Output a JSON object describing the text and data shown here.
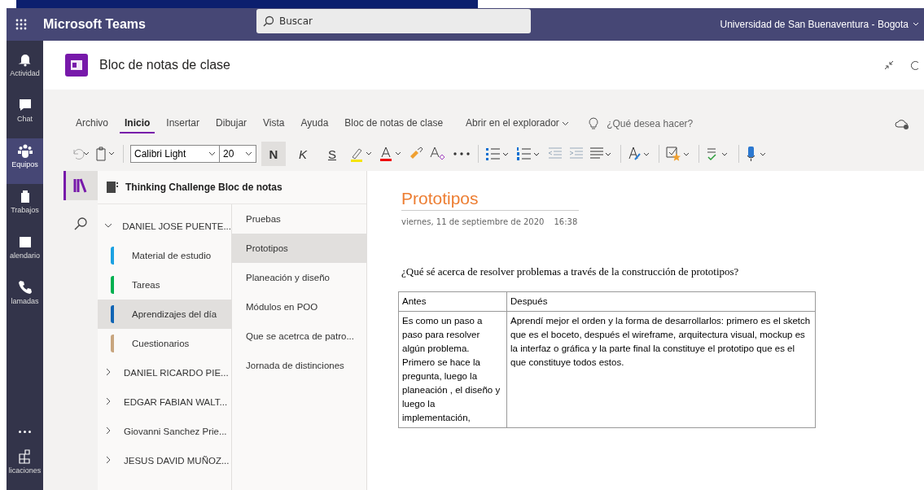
{
  "app": {
    "title": "Microsoft Teams",
    "search": {
      "placeholder": "Buscar"
    },
    "organization": "Universidad de San Buenaventura - Bogota"
  },
  "rail": [
    {
      "label": "Actividad",
      "selected": false
    },
    {
      "label": "Chat",
      "selected": false
    },
    {
      "label": "Equipos",
      "selected": true
    },
    {
      "label": "Trabajos",
      "selected": false
    },
    {
      "label": "alendario",
      "selected": false
    },
    {
      "label": "lamadas",
      "selected": false
    },
    {
      "label": "licaciones",
      "selected": false
    }
  ],
  "header": {
    "title": "Bloc de notas de clase"
  },
  "ribbon": {
    "tabs": [
      {
        "label": "Archivo",
        "selected": false
      },
      {
        "label": "Inicio",
        "selected": true
      },
      {
        "label": "Insertar",
        "selected": false
      },
      {
        "label": "Dibujar",
        "selected": false
      },
      {
        "label": "Vista",
        "selected": false
      },
      {
        "label": "Ayuda",
        "selected": false
      },
      {
        "label": "Bloc de notas de clase",
        "selected": false
      }
    ],
    "open_in": "Abrir en el explorador",
    "tell_me": {
      "placeholder": "¿Qué desea hacer?"
    },
    "font": "Calibri Light",
    "size": "20",
    "bold": "N",
    "italic": "K",
    "underline": "S",
    "bold_on": true
  },
  "notebook": {
    "title": "Thinking Challenge Bloc de notas",
    "groups": [
      {
        "label": "DANIEL JOSE PUENTE...",
        "expanded": true,
        "sections": [
          {
            "label": "Material de estudio",
            "color": "#1ba1e2",
            "selected": false
          },
          {
            "label": "Tareas",
            "color": "#00b050",
            "selected": false
          },
          {
            "label": "Aprendizajes del día",
            "color": "#0f64b4",
            "selected": true
          },
          {
            "label": "Cuestionarios",
            "color": "#c8a57e",
            "selected": false
          }
        ]
      },
      {
        "label": "DANIEL RICARDO PIE...",
        "expanded": false
      },
      {
        "label": "EDGAR FABIAN WALT...",
        "expanded": false
      },
      {
        "label": "Giovanni Sanchez Prie...",
        "expanded": false
      },
      {
        "label": "JESUS DAVID MUÑOZ...",
        "expanded": false
      }
    ],
    "pages": [
      {
        "label": "Pruebas",
        "selected": false
      },
      {
        "label": "Prototipos",
        "selected": true
      },
      {
        "label": "Planeación y diseño",
        "selected": false
      },
      {
        "label": "Módulos en POO",
        "selected": false
      },
      {
        "label": "Que se acetrca de patro...",
        "selected": false
      },
      {
        "label": "Jornada de distinciones",
        "selected": false
      }
    ]
  },
  "page": {
    "title": "Prototipos",
    "date": "viernes, 11 de septiembre de 2020",
    "time": "16:38",
    "question": "¿Qué sé acerca de resolver problemas a través de la construcción de prototipos?",
    "table": {
      "columns": [
        "Antes",
        "Después"
      ],
      "rows": [
        [
          " Es como un paso a paso para resolver algún problema.\nPrimero se hace la pregunta, luego la planeación , el diseño y luego la implementación,",
          " Aprendí mejor el orden y la forma de desarrollarlos: primero es el sketch que es el boceto, después el wireframe, arquitectura visual, mockup es la interfaz o gráfica y la parte final la constituye el prototipo que es el que constituye todos estos."
        ]
      ]
    }
  }
}
